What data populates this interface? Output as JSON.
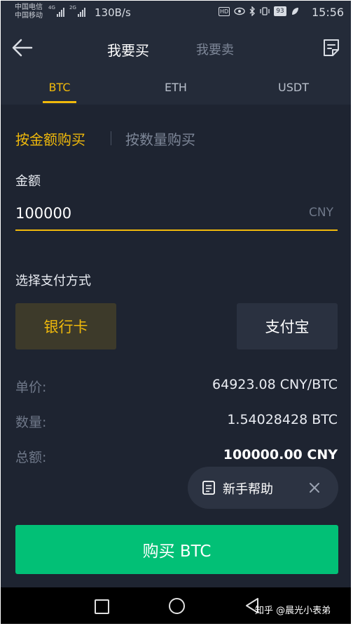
{
  "status_bar": {
    "carrier_1": "中国电信",
    "carrier_2": "中国移动",
    "net_1": "4G",
    "net_2": "2G",
    "speed": "130B/s",
    "hd": "HD",
    "battery": "93",
    "time": "15:56"
  },
  "header": {
    "tab_buy": "我要买",
    "tab_sell": "我要卖"
  },
  "coins": [
    "BTC",
    "ETH",
    "USDT"
  ],
  "mode": {
    "by_amount": "按金额购买",
    "by_quantity": "按数量购买"
  },
  "amount": {
    "label": "金额",
    "value": "100000",
    "unit": "CNY"
  },
  "payment": {
    "label": "选择支付方式",
    "bank": "银行卡",
    "alipay": "支付宝"
  },
  "summary": {
    "price_label": "单价:",
    "price_value": "64923.08 CNY/BTC",
    "qty_label": "数量:",
    "qty_value": "1.54028428 BTC",
    "total_label": "总额:",
    "total_value": "100000.00 CNY"
  },
  "help": {
    "label": "新手帮助"
  },
  "buy_button": "购买 BTC",
  "watermark": "知乎 @晨光小表弟",
  "colors": {
    "accent": "#f0b90b",
    "buy_green": "#02c076",
    "background": "#1e2431"
  }
}
